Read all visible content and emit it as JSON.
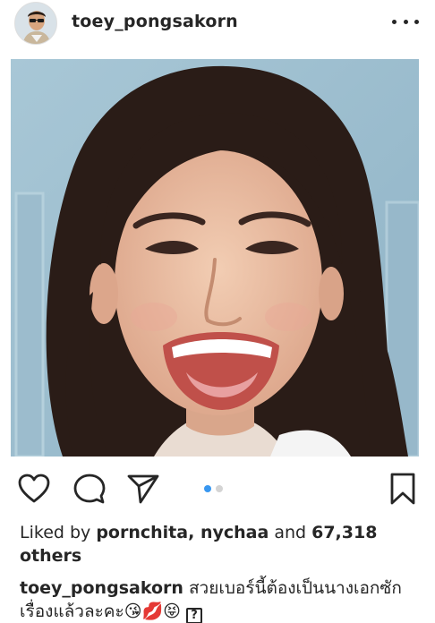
{
  "header": {
    "username": "toey_pongsakorn",
    "more_icon": "more-horizontal-icon"
  },
  "photo": {
    "description_icon": "photo"
  },
  "actions": {
    "like_icon": "heart-icon",
    "comment_icon": "comment-icon",
    "share_icon": "send-icon",
    "save_icon": "bookmark-icon",
    "carousel_total": 2,
    "carousel_active": 1,
    "accent_color": "#3897f0"
  },
  "likes": {
    "prefix": "Liked by ",
    "user1": "pornchita",
    "separator": ", ",
    "user2": "nychaa",
    "and": " and ",
    "count": "67,318",
    "suffix": " others"
  },
  "caption": {
    "username": "toey_pongsakorn",
    "text": " สวยเบอร์นี้ต้องเป็นนางเอกซักเรื่องแล้วละคะ",
    "emojis": "😘💋😝",
    "box_glyph": "?"
  }
}
